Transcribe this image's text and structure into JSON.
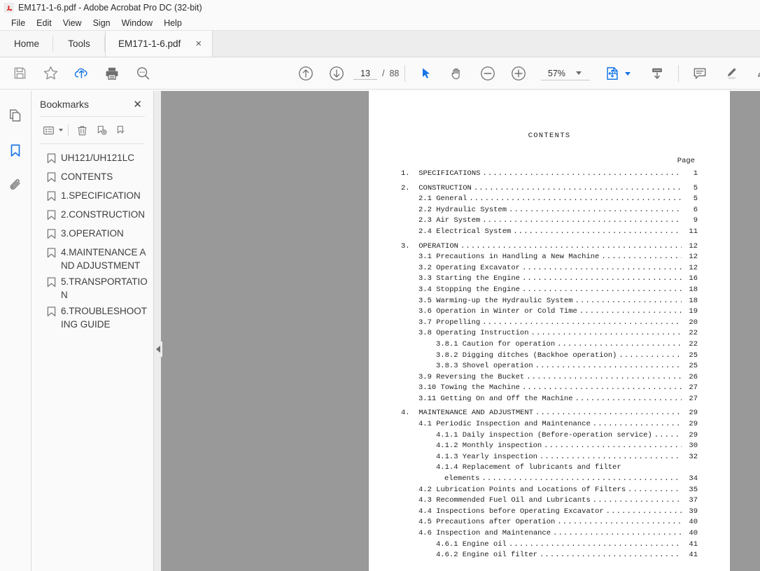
{
  "window": {
    "title": "EM171-1-6.pdf - Adobe Acrobat Pro DC (32-bit)",
    "app_icon": "acrobat-logo-icon"
  },
  "menubar": {
    "items": [
      {
        "label": "File"
      },
      {
        "label": "Edit"
      },
      {
        "label": "View"
      },
      {
        "label": "Sign"
      },
      {
        "label": "Window"
      },
      {
        "label": "Help"
      }
    ]
  },
  "tabs": {
    "home_label": "Home",
    "tools_label": "Tools",
    "document_label": "EM171-1-6.pdf",
    "close_glyph": "×"
  },
  "toolbar": {
    "left_tools": [
      {
        "name": "save-icon",
        "title": "Save"
      },
      {
        "name": "star-icon",
        "title": "Add to favorites"
      },
      {
        "name": "cloud-upload-icon",
        "title": "Upload to cloud"
      },
      {
        "name": "print-icon",
        "title": "Print"
      },
      {
        "name": "search-icon",
        "title": "Find"
      }
    ],
    "previous_page_icon": "arrow-up-circle-icon",
    "next_page_icon": "arrow-down-circle-icon",
    "page_number": "13",
    "page_separator": "/",
    "page_total": "88",
    "select_tool_icon": "cursor-arrow-icon",
    "hand_tool_icon": "hand-icon",
    "zoom_out_icon": "zoom-out-circle-icon",
    "zoom_in_icon": "zoom-in-circle-icon",
    "zoom_value": "57%",
    "page_fit_icon": "page-fit-icon",
    "rotate_icon": "collapse-toolbar-icon",
    "comment_icon": "comment-icon",
    "highlight_icon": "highlighter-icon",
    "extra_icon": "edit-pdf-icon",
    "accent_color": "#1473e6"
  },
  "icon_rail": {
    "items": [
      {
        "name": "page-thumbnails-icon",
        "label": "Page Thumbnails",
        "active": false
      },
      {
        "name": "bookmarks-icon",
        "label": "Bookmarks",
        "active": true
      },
      {
        "name": "attachments-icon",
        "label": "Attachments",
        "active": false
      }
    ]
  },
  "bookmarks_panel": {
    "title": "Bookmarks",
    "close_glyph": "✕",
    "toolbar": [
      {
        "name": "bookmark-options-icon",
        "label": "Options"
      },
      {
        "name": "delete-bookmark-icon",
        "label": "Delete Bookmark"
      },
      {
        "name": "new-bookmark-icon",
        "label": "New Bookmark"
      },
      {
        "name": "edit-bookmark-icon",
        "label": "Edit Bookmark"
      }
    ],
    "items": [
      {
        "label": "UH121/UH121LC"
      },
      {
        "label": "CONTENTS"
      },
      {
        "label": "1.SPECIFICATION"
      },
      {
        "label": "2.CONSTRUCTION"
      },
      {
        "label": "3.OPERATION"
      },
      {
        "label": "4.MAINTENANCE AND ADJUSTMENT"
      },
      {
        "label": "5.TRANSPORTATION"
      },
      {
        "label": "6.TROUBLESHOOTING GUIDE"
      }
    ],
    "collapse_icon": "collapse-panel-arrow-icon"
  },
  "document": {
    "heading": "CONTENTS",
    "page_column_header": "Page",
    "toc": [
      {
        "num": "1.",
        "text": "SPECIFICATIONS",
        "page": "1",
        "indent": 0,
        "gap": false
      },
      {
        "num": "2.",
        "text": "CONSTRUCTION",
        "page": "5",
        "indent": 0,
        "gap": true
      },
      {
        "num": "",
        "text": "2.1 General",
        "page": "5",
        "indent": 1,
        "gap": false
      },
      {
        "num": "",
        "text": "2.2 Hydraulic System",
        "page": "6",
        "indent": 1,
        "gap": false
      },
      {
        "num": "",
        "text": "2.3 Air System",
        "page": "9",
        "indent": 1,
        "gap": false
      },
      {
        "num": "",
        "text": "2.4 Electrical System",
        "page": "11",
        "indent": 1,
        "gap": false
      },
      {
        "num": "3.",
        "text": "OPERATION",
        "page": "12",
        "indent": 0,
        "gap": true
      },
      {
        "num": "",
        "text": "3.1 Precautions in Handling a New Machine",
        "page": "12",
        "indent": 1,
        "gap": false
      },
      {
        "num": "",
        "text": "3.2 Operating Excavator",
        "page": "12",
        "indent": 1,
        "gap": false
      },
      {
        "num": "",
        "text": "3.3 Starting the Engine",
        "page": "16",
        "indent": 1,
        "gap": false
      },
      {
        "num": "",
        "text": "3.4 Stopping the Engine",
        "page": "18",
        "indent": 1,
        "gap": false
      },
      {
        "num": "",
        "text": "3.5 Warming-up the Hydraulic System",
        "page": "18",
        "indent": 1,
        "gap": false
      },
      {
        "num": "",
        "text": "3.6 Operation in Winter or Cold Time",
        "page": "19",
        "indent": 1,
        "gap": false
      },
      {
        "num": "",
        "text": "3.7 Propelling",
        "page": "20",
        "indent": 1,
        "gap": false
      },
      {
        "num": "",
        "text": "3.8 Operating Instruction",
        "page": "22",
        "indent": 1,
        "gap": false
      },
      {
        "num": "",
        "text": "3.8.1 Caution for operation",
        "page": "22",
        "indent": 2,
        "gap": false
      },
      {
        "num": "",
        "text": "3.8.2 Digging ditches (Backhoe operation)",
        "page": "25",
        "indent": 2,
        "gap": false
      },
      {
        "num": "",
        "text": "3.8.3 Shovel operation",
        "page": "25",
        "indent": 2,
        "gap": false
      },
      {
        "num": "",
        "text": "3.9 Reversing the Bucket",
        "page": "26",
        "indent": 1,
        "gap": false
      },
      {
        "num": "",
        "text": "3.10 Towing the Machine",
        "page": "27",
        "indent": 1,
        "gap": false
      },
      {
        "num": "",
        "text": "3.11 Getting On and Off the Machine",
        "page": "27",
        "indent": 1,
        "gap": false
      },
      {
        "num": "4.",
        "text": "MAINTENANCE AND ADJUSTMENT",
        "page": "29",
        "indent": 0,
        "gap": true
      },
      {
        "num": "",
        "text": "4.1 Periodic Inspection and Maintenance",
        "page": "29",
        "indent": 1,
        "gap": false
      },
      {
        "num": "",
        "text": "4.1.1 Daily inspection (Before-operation service)",
        "page": "29",
        "indent": 2,
        "gap": false
      },
      {
        "num": "",
        "text": "4.1.2 Monthly inspection",
        "page": "30",
        "indent": 2,
        "gap": false
      },
      {
        "num": "",
        "text": "4.1.3 Yearly inspection",
        "page": "32",
        "indent": 2,
        "gap": false
      },
      {
        "num": "",
        "text": "4.1.4 Replacement of lubricants and filter",
        "page": "",
        "indent": 2,
        "gap": false,
        "nodots": true
      },
      {
        "num": "",
        "text": "elements",
        "page": "34",
        "indent": 3,
        "gap": false
      },
      {
        "num": "",
        "text": "4.2 Lubrication Points and Locations of Filters",
        "page": "35",
        "indent": 1,
        "gap": false
      },
      {
        "num": "",
        "text": "4.3 Recommended Fuel Oil and Lubricants",
        "page": "37",
        "indent": 1,
        "gap": false
      },
      {
        "num": "",
        "text": "4.4 Inspections before Operating Excavator",
        "page": "39",
        "indent": 1,
        "gap": false
      },
      {
        "num": "",
        "text": "4.5 Precautions after Operation",
        "page": "40",
        "indent": 1,
        "gap": false
      },
      {
        "num": "",
        "text": "4.6 Inspection and Maintenance",
        "page": "40",
        "indent": 1,
        "gap": false
      },
      {
        "num": "",
        "text": "4.6.1 Engine oil",
        "page": "41",
        "indent": 2,
        "gap": false
      },
      {
        "num": "",
        "text": "4.6.2 Engine oil filter",
        "page": "41",
        "indent": 2,
        "gap": false
      }
    ]
  }
}
